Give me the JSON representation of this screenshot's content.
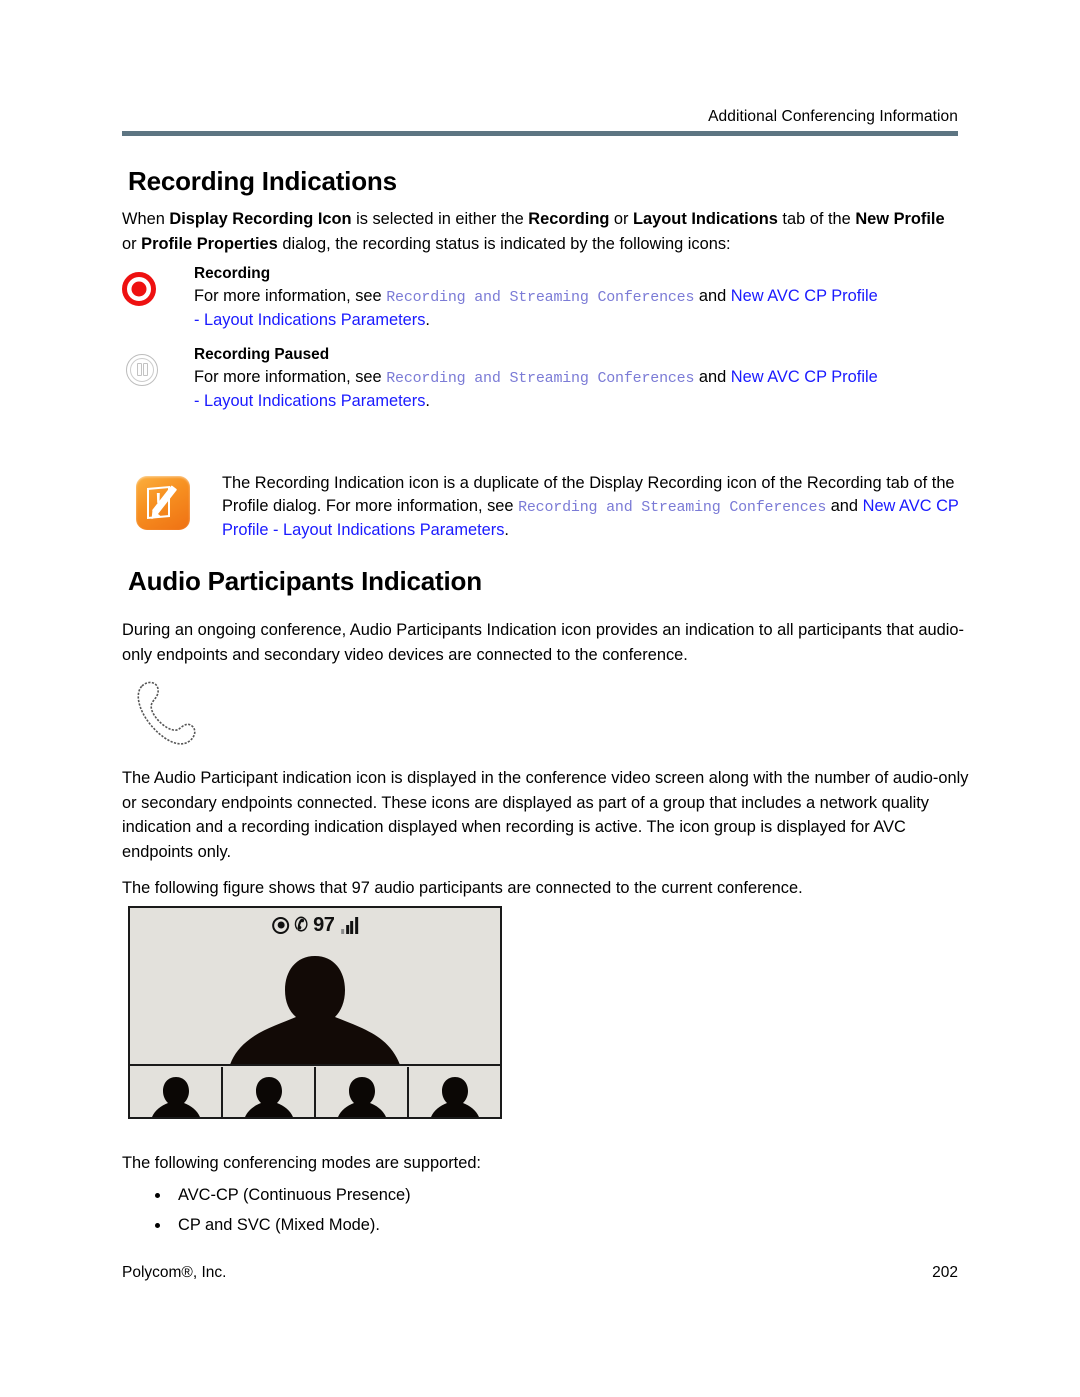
{
  "header": {
    "running_head": "Additional Conferencing Information",
    "rule_color": "#5d7582"
  },
  "sections": {
    "recording": {
      "title": "Recording Indications",
      "intro": {
        "p1_a": "When ",
        "p1_b1": "Display Recording Icon",
        "p1_c": " is selected in either the ",
        "p1_b2": "Recording",
        "p1_d": " or ",
        "p1_b3": "Layout Indications",
        "p1_e": " tab of the ",
        "p1_b4": "New Profile",
        "p1_f": " or ",
        "p1_b5": "Profile Properties",
        "p1_g": " dialog, the recording status is indicated by the following icons:"
      },
      "definitions": [
        {
          "icon": "recording-icon",
          "term": "Recording",
          "lead": "For more information, see ",
          "xref_mono": "Recording and Streaming Conferences",
          "conj": " and ",
          "xref_link": "New AVC CP Profile",
          "xref_link_cont": "- Layout Indications Parameters",
          "period": "."
        },
        {
          "icon": "recording-paused-icon",
          "term": "Recording Paused",
          "lead": "For more information, see ",
          "xref_mono": "Recording and Streaming Conferences",
          "conj": " and ",
          "xref_link": "New AVC CP Profile",
          "xref_link_cont": "- Layout Indications Parameters",
          "period": "."
        }
      ],
      "note": {
        "icon": "note-pencil-icon",
        "t1": "The Recording Indication icon is a duplicate of the Display Recording icon of the Recording tab of the Profile dialog. For more information, see ",
        "xref_mono": "Recording and Streaming Conferences",
        "conj": " and ",
        "xref_link": "New AVC CP Profile - Layout Indications Parameters",
        "period": "."
      }
    },
    "audio": {
      "title": "Audio Participants Indication",
      "intro": "During an ongoing conference, Audio Participants Indication icon provides an indication to all participants that audio-only endpoints and secondary video devices are connected to the conference.",
      "handset_icon": "telephone-handset-icon",
      "description": "The Audio Participant indication icon is displayed in the conference video screen along with the number of audio-only or secondary endpoints connected. These icons are displayed as part of a group that includes a network quality indication and a recording indication displayed when recording is active. The icon group is displayed for AVC endpoints only.",
      "figure_lead": "The following figure shows that 97 audio participants are connected to the current conference.",
      "figure": {
        "participant_count": "97",
        "recording_icon": "recording-dot-icon",
        "handset_icon": "handset-glyph-icon",
        "signal_icon": "signal-bars-icon",
        "handset_glyph": "✆",
        "thumbnail_count": 4
      },
      "modes_lead": "The following conferencing modes are supported:",
      "modes": [
        "AVC-CP (Continuous Presence)",
        "CP and SVC (Mixed Mode)."
      ]
    }
  },
  "footer": {
    "company": "Polycom®, Inc.",
    "page_number": "202"
  },
  "colors": {
    "link_blue": "#1a1aff",
    "xref_mono": "#7b7bd6",
    "rule": "#5d7582",
    "recording_red": "#ee1111",
    "note_orange": "#f79121"
  }
}
